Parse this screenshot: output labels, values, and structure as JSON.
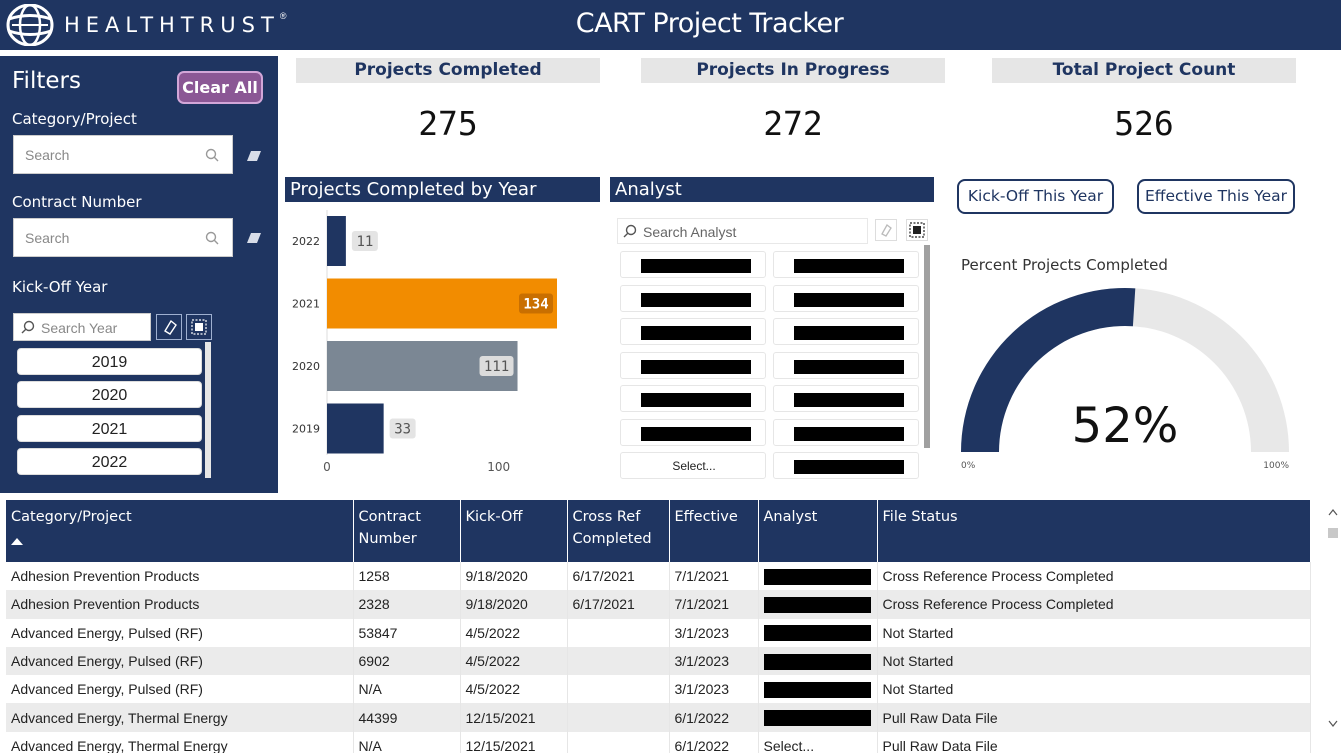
{
  "header": {
    "logo_text": "HEALTHTRUST",
    "logo_mark": "®",
    "title": "CART Project Tracker"
  },
  "filters": {
    "title": "Filters",
    "clear_all": "Clear All",
    "category_label": "Category/Project",
    "category_placeholder": "Search",
    "contract_label": "Contract Number",
    "contract_placeholder": "Search",
    "kickoff_label": "Kick-Off Year",
    "year_placeholder": "Search Year",
    "years": [
      "2019",
      "2020",
      "2021",
      "2022"
    ]
  },
  "kpis": [
    {
      "label": "Projects Completed",
      "value": "275"
    },
    {
      "label": "Projects In Progress",
      "value": "272"
    },
    {
      "label": "Total Project Count",
      "value": "526"
    }
  ],
  "completed_by_year": {
    "title": "Projects Completed by Year"
  },
  "analyst": {
    "title": "Analyst",
    "search_placeholder": "Search Analyst",
    "select_label": "Select..."
  },
  "buttons": {
    "kickoff_this_year": "Kick-Off This Year",
    "effective_this_year": "Effective This Year"
  },
  "gauge": {
    "title": "Percent Projects Completed",
    "value_label": "52%",
    "value": 0.52,
    "min_label": "0%",
    "max_label": "100%",
    "fill_color": "#1f3561",
    "track_color": "#e8e8e8"
  },
  "chart_data": {
    "type": "bar",
    "orientation": "horizontal",
    "categories": [
      "2022",
      "2021",
      "2020",
      "2019"
    ],
    "values": [
      11,
      134,
      111,
      33
    ],
    "colors": [
      "#1f3561",
      "#f28c00",
      "#7b8794",
      "#1f3561"
    ],
    "xlim": [
      0,
      134
    ],
    "xticks": [
      "0",
      "100"
    ],
    "title": "Projects Completed by Year"
  },
  "table": {
    "columns": [
      "Category/Project",
      "Contract Number",
      "Kick-Off",
      "Cross Ref Completed",
      "Effective",
      "Analyst",
      "File Status"
    ],
    "rows": [
      [
        "Adhesion Prevention Products",
        "1258",
        "9/18/2020",
        "6/17/2021",
        "7/1/2021",
        "",
        "Cross Reference Process Completed"
      ],
      [
        "Adhesion Prevention Products",
        "2328",
        "9/18/2020",
        "6/17/2021",
        "7/1/2021",
        "",
        "Cross Reference Process Completed"
      ],
      [
        "Advanced Energy, Pulsed (RF)",
        "53847",
        "4/5/2022",
        "",
        "3/1/2023",
        "",
        "Not Started"
      ],
      [
        "Advanced Energy, Pulsed (RF)",
        "6902",
        "4/5/2022",
        "",
        "3/1/2023",
        "",
        "Not Started"
      ],
      [
        "Advanced Energy, Pulsed (RF)",
        "N/A",
        "4/5/2022",
        "",
        "3/1/2023",
        "",
        "Not Started"
      ],
      [
        "Advanced Energy, Thermal Energy",
        "44399",
        "12/15/2021",
        "",
        "6/1/2022",
        "",
        "Pull Raw Data File"
      ],
      [
        "Advanced Energy, Thermal Energy",
        "N/A",
        "12/15/2021",
        "",
        "6/1/2022",
        "Select...",
        "Pull Raw Data File"
      ]
    ]
  }
}
